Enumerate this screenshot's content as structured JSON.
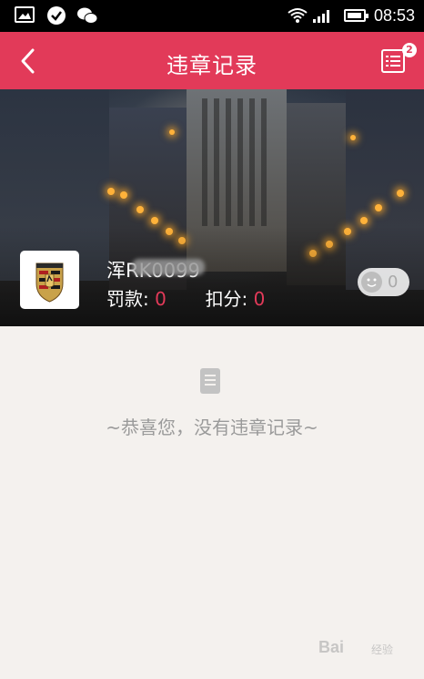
{
  "status_bar": {
    "time": "08:53",
    "icons": [
      "gallery-icon",
      "check-circle-icon",
      "wechat-icon",
      "wifi-icon",
      "signal-icon",
      "battery-icon"
    ]
  },
  "header": {
    "title": "违章记录",
    "back_icon": "chevron-left-icon",
    "menu_icon": "list-icon",
    "badge": "2",
    "color": "#e23a59"
  },
  "car": {
    "logo": "porsche-logo",
    "plate": "浑RK0099",
    "fine_label": "罚款:",
    "fine_value": "0",
    "points_label": "扣分:",
    "points_value": "0",
    "like_count": "0"
  },
  "empty_state": {
    "icon": "document-icon",
    "message": "~恭喜您，没有违章记录~"
  },
  "watermark": {
    "text": "Bai",
    "sub": "经验"
  }
}
